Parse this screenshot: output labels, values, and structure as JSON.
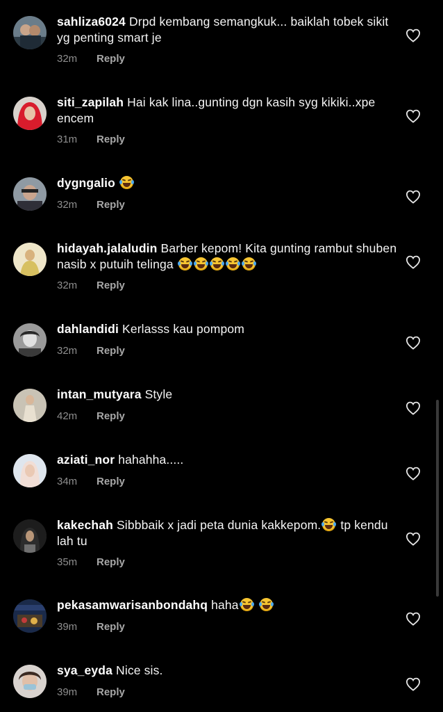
{
  "comments": [
    {
      "username": "sahliza6024",
      "text": "Drpd kembang semangkuk... baiklah tobek sikit yg penting smart je",
      "emoji_count": 0,
      "time": "32m",
      "reply": "Reply"
    },
    {
      "username": "siti_zapilah",
      "text": "Hai kak lina..gunting dgn kasih syg kikiki..xpe encem",
      "emoji_count": 0,
      "time": "31m",
      "reply": "Reply"
    },
    {
      "username": "dygngalio",
      "text": "",
      "emoji_count": 1,
      "time": "32m",
      "reply": "Reply"
    },
    {
      "username": "hidayah.jalaludin",
      "text": "Barber kepom! Kita gunting rambut shuben nasib x putuih telinga",
      "emoji_count": 5,
      "time": "32m",
      "reply": "Reply"
    },
    {
      "username": "dahlandidi",
      "text": "Kerlasss kau pompom",
      "emoji_count": 0,
      "time": "32m",
      "reply": "Reply"
    },
    {
      "username": "intan_mutyara",
      "text": "Style",
      "emoji_count": 0,
      "time": "42m",
      "reply": "Reply"
    },
    {
      "username": "aziati_nor",
      "text": "hahahha.....",
      "emoji_count": 0,
      "time": "34m",
      "reply": "Reply"
    },
    {
      "username": "kakechah",
      "text": "Sibbbaik x jadi peta dunia kakkepom.",
      "text_after": "tp kendu lah tu",
      "emoji_count": 1,
      "time": "35m",
      "reply": "Reply"
    },
    {
      "username": "pekasamwarisanbondahq",
      "text": "haha",
      "emoji_count": 2,
      "time": "39m",
      "reply": "Reply"
    },
    {
      "username": "sya_eyda",
      "text": "Nice sis.",
      "emoji_count": 0,
      "time": "39m",
      "reply": "Reply"
    }
  ],
  "emoji_name": "face-with-tears-of-joy",
  "colors": {
    "background": "#000000",
    "text": "#ffffff",
    "meta": "#8e8e8e"
  }
}
